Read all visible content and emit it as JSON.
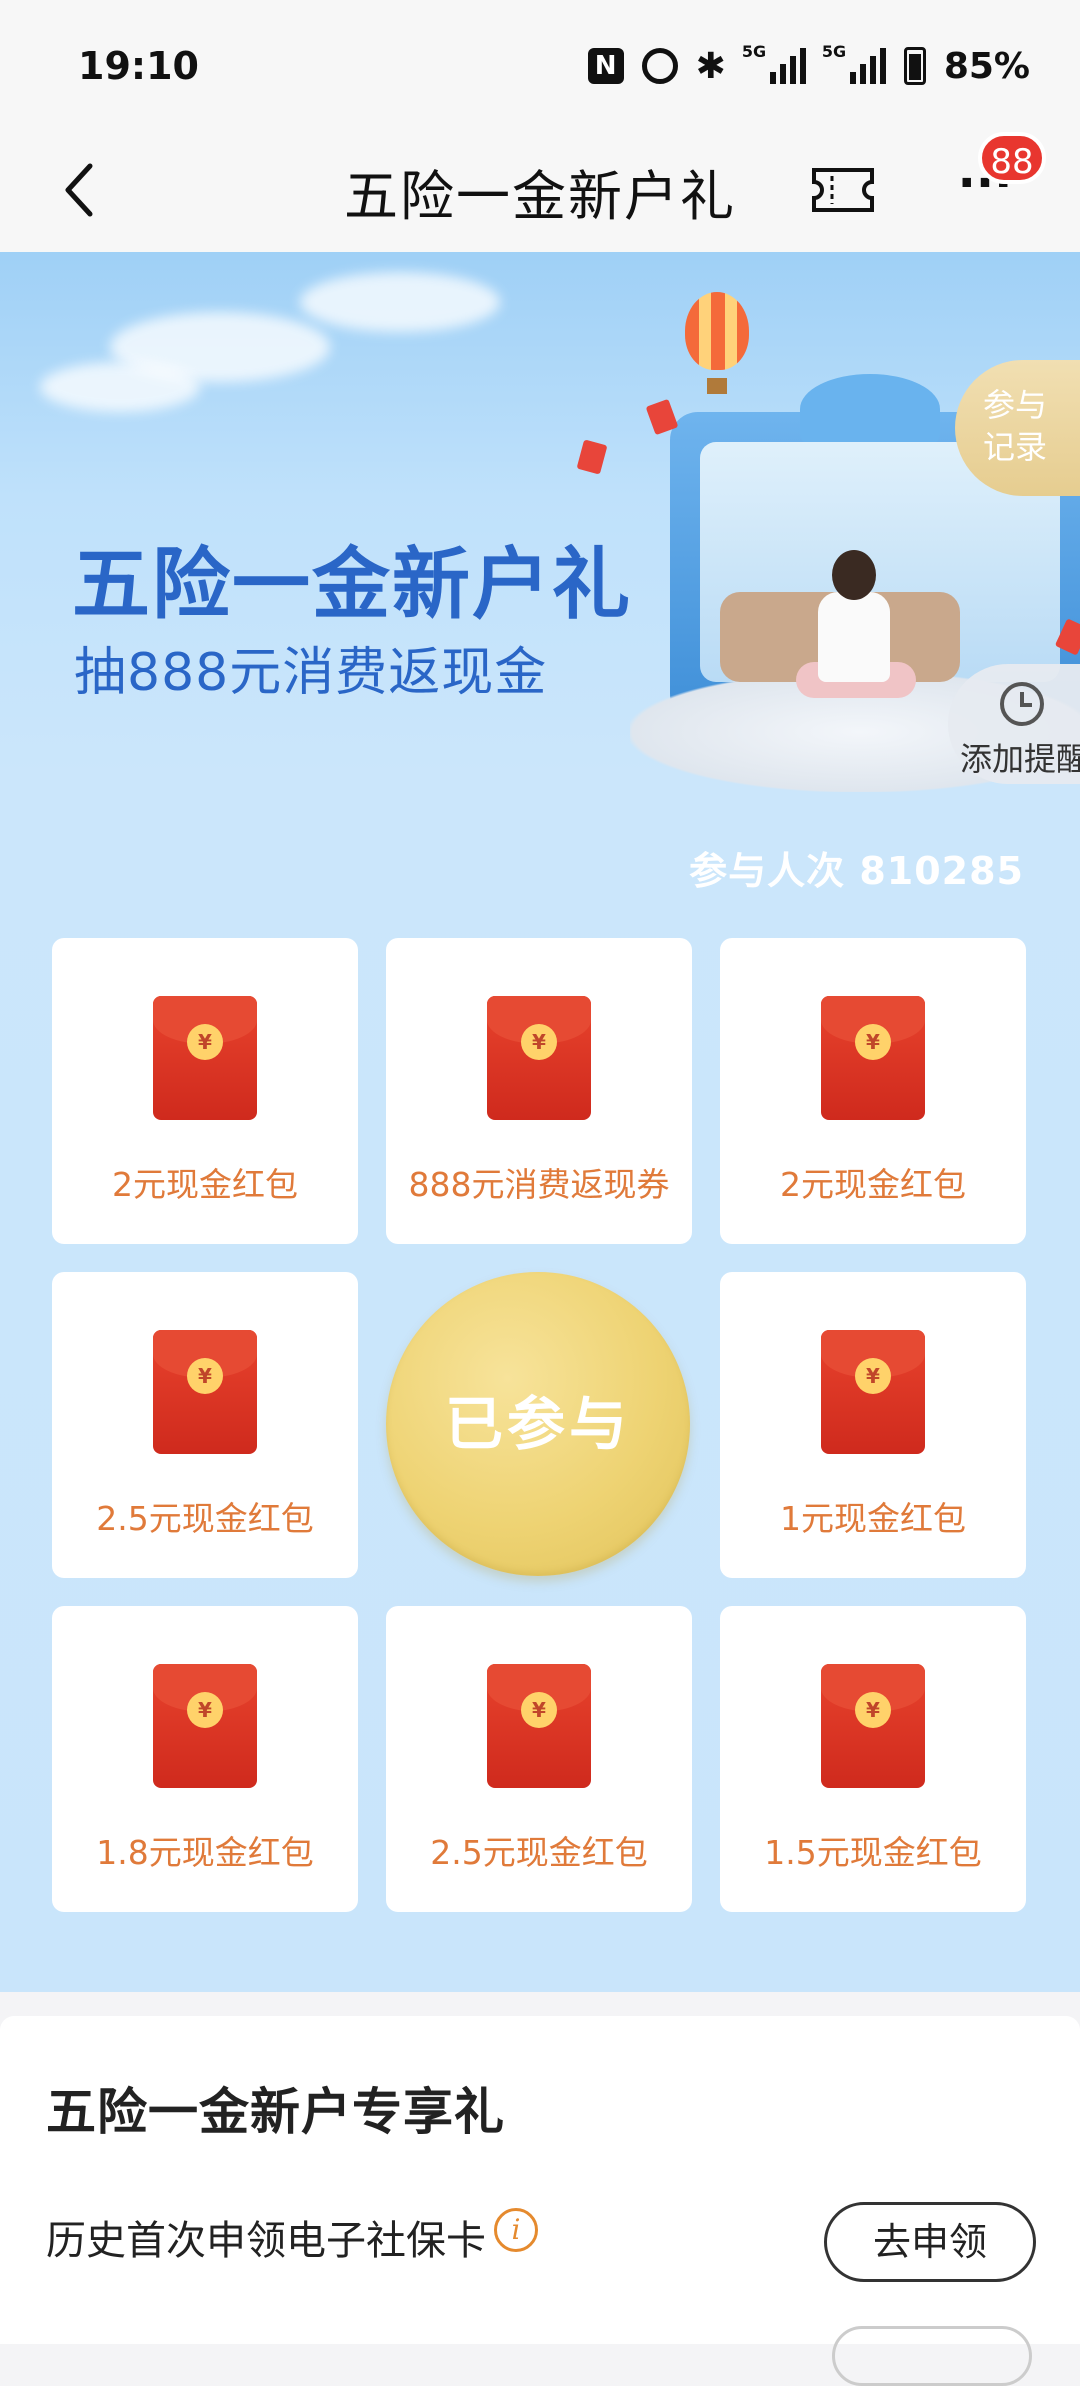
{
  "status": {
    "time": "19:10",
    "battery": "85%",
    "nfc": "N",
    "net1": "5G",
    "net2": "5G"
  },
  "nav": {
    "title": "五险一金新户礼",
    "badge": "88"
  },
  "hero": {
    "title": "五险一金新户礼",
    "subtitle": "抽888元消费返现金",
    "records_tab": "参与记录",
    "reminder_tab": "添加提醒",
    "participants": "参与人次 810285"
  },
  "prizes": [
    "2元现金红包",
    "888元消费返现券",
    "2元现金红包",
    "2.5元现金红包",
    "1元现金红包",
    "1.8元现金红包",
    "2.5元现金红包",
    "1.5元现金红包"
  ],
  "center_button": "已参与",
  "section": {
    "title": "五险一金新户专享礼",
    "row_label": "历史首次申领电子社保卡",
    "apply_label": "去申领"
  },
  "icons": [
    "back-arrow-icon",
    "ticket-icon",
    "more-icon",
    "clock-icon",
    "info-icon",
    "red-envelope-icon"
  ],
  "colors": {
    "accent_blue": "#2a66c7",
    "prize_orange": "#e07a3a",
    "badge_red": "#e8362f",
    "gold": "#eed373"
  }
}
